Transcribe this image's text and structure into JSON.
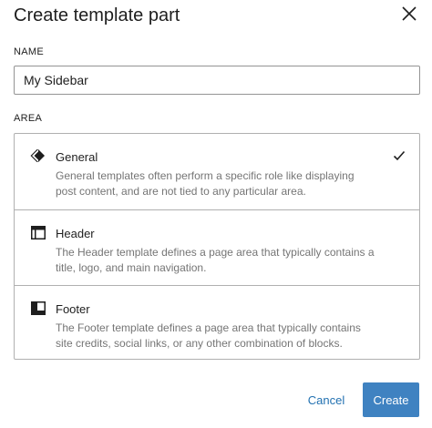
{
  "dialog": {
    "title": "Create template part",
    "close_icon": "close-icon"
  },
  "name_field": {
    "label": "NAME",
    "value": "My Sidebar"
  },
  "area_field": {
    "label": "AREA",
    "options": [
      {
        "title": "General",
        "description": "General templates often perform a specific role like displaying post content, and are not tied to any particular area.",
        "icon": "general-diamond-icon",
        "selected": true
      },
      {
        "title": "Header",
        "description": "The Header template defines a page area that typically contains a title, logo, and main navigation.",
        "icon": "header-layout-icon",
        "selected": false
      },
      {
        "title": "Footer",
        "description": "The Footer template defines a page area that typically contains site credits, social links, or any other combination of blocks.",
        "icon": "footer-layout-icon",
        "selected": false
      }
    ]
  },
  "actions": {
    "cancel_label": "Cancel",
    "create_label": "Create"
  },
  "colors": {
    "primary": "#3f82c1",
    "link": "#2271b1",
    "text": "#1e1e1e",
    "muted": "#757575",
    "border": "#b0b0b0"
  }
}
